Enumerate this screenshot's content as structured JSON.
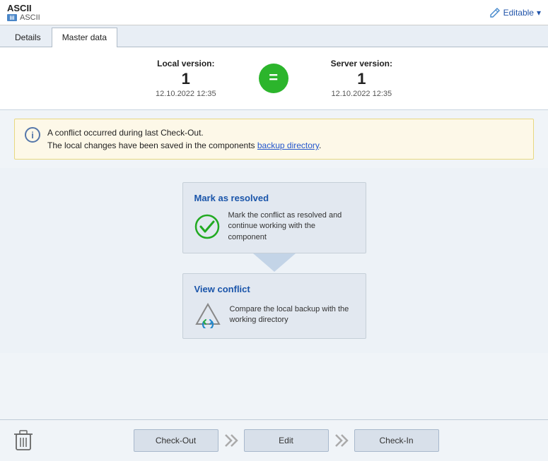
{
  "titleBar": {
    "appName": "ASCII",
    "subLabel": "ASCII",
    "editableLabel": "Editable",
    "dropdownArrow": "▾"
  },
  "tabs": [
    {
      "id": "details",
      "label": "Details",
      "active": false
    },
    {
      "id": "master-data",
      "label": "Master data",
      "active": true
    }
  ],
  "versions": {
    "local": {
      "label": "Local version:",
      "number": "1",
      "date": "12.10.2022 12:35"
    },
    "server": {
      "label": "Server version:",
      "number": "1",
      "date": "12.10.2022 12:35"
    },
    "equalsSymbol": "="
  },
  "infoBanner": {
    "icon": "i",
    "line1": "A conflict occurred during last Check-Out.",
    "line2": "The local changes have been saved in the components ",
    "linkText": "backup directory",
    "line2End": "."
  },
  "actions": {
    "markResolved": {
      "title": "Mark as resolved",
      "description": "Mark the conflict as resolved and continue working with the component"
    },
    "viewConflict": {
      "title": "View conflict",
      "description": "Compare the local backup with the working directory"
    }
  },
  "bottomBar": {
    "checkOut": "Check-Out",
    "edit": "Edit",
    "checkIn": "Check-In"
  }
}
